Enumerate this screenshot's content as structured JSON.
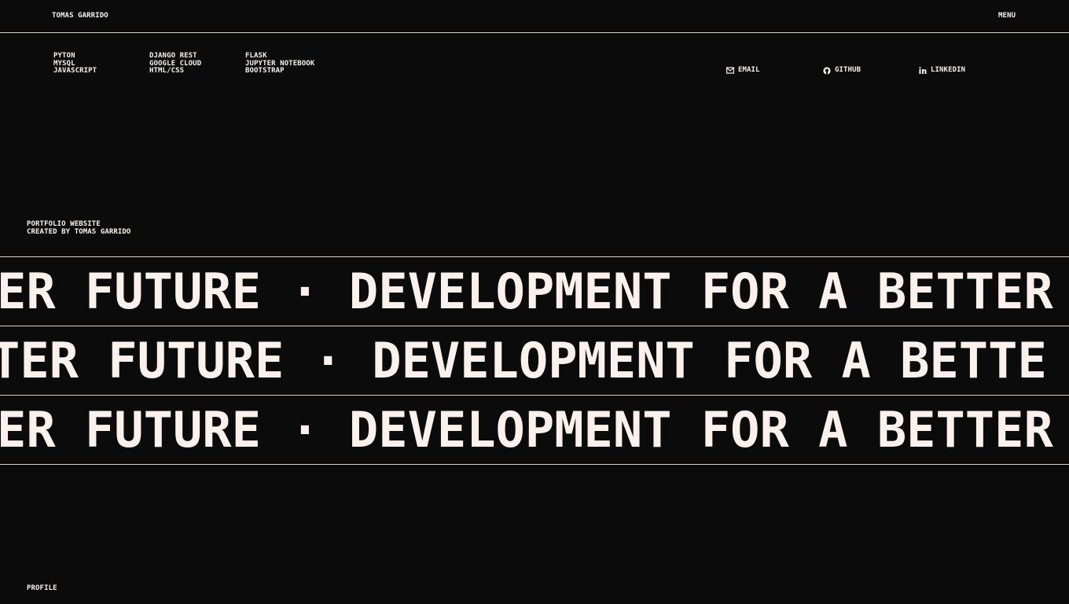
{
  "header": {
    "brand": "TOMAS GARRIDO",
    "menu_label": "MENU"
  },
  "skills": {
    "col1": [
      "PYTON",
      "MYSQL",
      "JAVASCRIPT"
    ],
    "col2": [
      "DJANGO REST",
      "GOOGLE CLOUD",
      "HTML/CSS"
    ],
    "col3": [
      "FLASK",
      "JUPYTER NOTEBOOK",
      "BOOTSTRAP"
    ]
  },
  "contacts": [
    {
      "label": "EMAIL",
      "icon": "envelope-icon"
    },
    {
      "label": "GITHUB",
      "icon": "github-icon"
    },
    {
      "label": "LINKEDIN",
      "icon": "linkedin-icon"
    }
  ],
  "info": {
    "line1": "PORTFOLIO WEBSITE",
    "line2": "CREATED BY TOMAS GARRIDO"
  },
  "marquee": {
    "row1": "ER FUTURE · DEVELOPMENT FOR A BETTER",
    "row2": "TER FUTURE · DEVELOPMENT FOR A BETTE",
    "row3": "ER FUTURE · DEVELOPMENT FOR A BETTER"
  },
  "footer": {
    "profile_label": "PROFILE"
  },
  "colors": {
    "background": "#0b0b0b",
    "text": "#faf1ec",
    "rule": "#d9d2cd"
  }
}
